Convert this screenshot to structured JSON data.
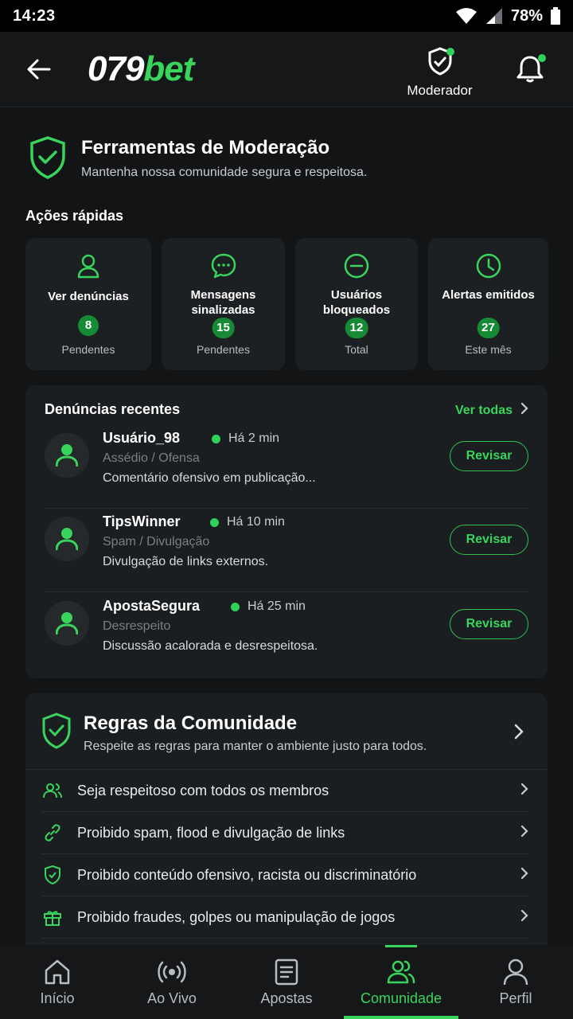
{
  "status_bar": {
    "time": "14:23",
    "battery": "78%"
  },
  "header": {
    "logo_num": "079",
    "logo_bet": "bet",
    "moderator_label": "Moderador"
  },
  "hero": {
    "title": "Ferramentas de Moderação",
    "subtitle": "Mantenha nossa comunidade segura e respeitosa."
  },
  "quick_actions": {
    "title": "Ações rápidas",
    "cards": [
      {
        "label": "Ver denúncias",
        "count": "8",
        "sub": "Pendentes",
        "icon": "user-icon"
      },
      {
        "label": "Mensagens sinalizadas",
        "count": "15",
        "sub": "Pendentes",
        "icon": "chat-icon"
      },
      {
        "label": "Usuários bloqueados",
        "count": "12",
        "sub": "Total",
        "icon": "block-icon"
      },
      {
        "label": "Alertas emitidos",
        "count": "27",
        "sub": "Este mês",
        "icon": "clock-icon"
      }
    ]
  },
  "reports": {
    "title": "Denúncias recentes",
    "see_all": "Ver todas",
    "items": [
      {
        "user": "Usuário_98",
        "time": "Há 2 min",
        "category": "Assédio / Ofensa",
        "desc": "Comentário ofensivo em publicação...",
        "action": "Revisar"
      },
      {
        "user": "TipsWinner",
        "time": "Há 10 min",
        "category": "Spam / Divulgação",
        "desc": "Divulgação de links externos.",
        "action": "Revisar"
      },
      {
        "user": "ApostaSegura",
        "time": "Há 25 min",
        "category": "Desrespeito",
        "desc": "Discussão acalorada e desrespeitosa.",
        "action": "Revisar"
      }
    ]
  },
  "rules": {
    "title": "Regras da Comunidade",
    "subtitle": "Respeite as regras para manter o ambiente justo para todos.",
    "items": [
      {
        "text": "Seja respeitoso com todos os membros",
        "icon": "users-icon"
      },
      {
        "text": "Proibido spam, flood e divulgação de links",
        "icon": "link-icon"
      },
      {
        "text": "Proibido conteúdo ofensivo, racista ou discriminatório",
        "icon": "shield-check-icon"
      },
      {
        "text": "Proibido fraudes, golpes ou manipulação de jogos",
        "icon": "gift-icon"
      }
    ]
  },
  "nav": {
    "items": [
      {
        "label": "Início",
        "icon": "home-icon"
      },
      {
        "label": "Ao Vivo",
        "icon": "live-icon"
      },
      {
        "label": "Apostas",
        "icon": "ticket-icon"
      },
      {
        "label": "Comunidade",
        "icon": "community-icon",
        "active": true
      },
      {
        "label": "Perfil",
        "icon": "profile-icon"
      }
    ]
  },
  "colors": {
    "accent": "#38d45c",
    "background": "#121416",
    "card": "#1d2023"
  }
}
